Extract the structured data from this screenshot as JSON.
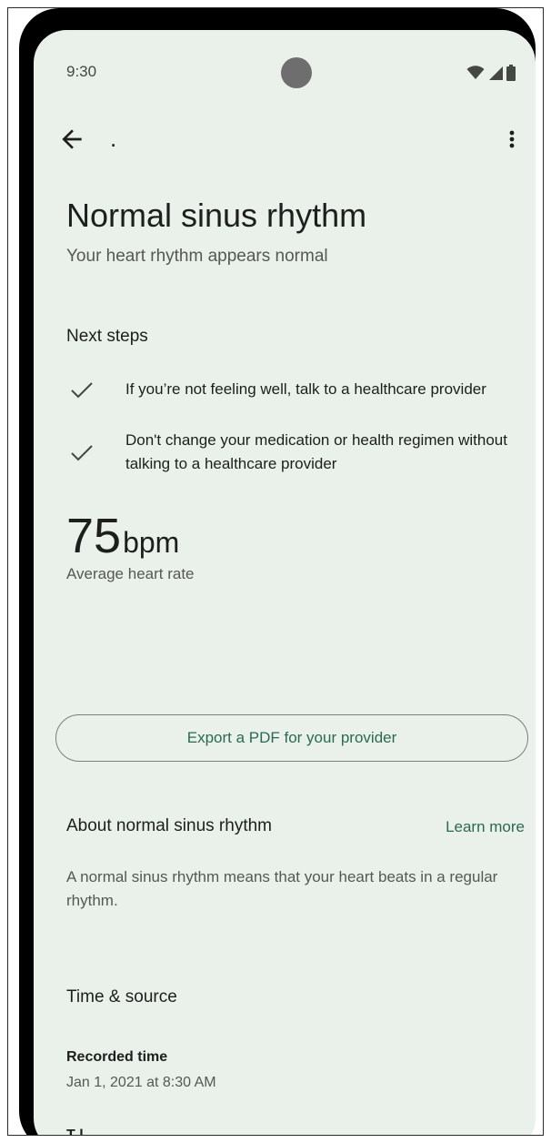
{
  "status_bar": {
    "time": "9:30",
    "icons": [
      "wifi-icon",
      "cell-signal-icon",
      "battery-icon"
    ]
  },
  "app_bar": {
    "title": ".",
    "back_icon": "arrow-left-icon",
    "more_icon": "more-vert-icon"
  },
  "result": {
    "title": "Normal sinus rhythm",
    "subtitle": "Your heart rhythm appears normal"
  },
  "next_steps": {
    "heading": "Next steps",
    "items": [
      {
        "icon": "check-icon",
        "text": "If you’re not feeling well, talk to a healthcare provider"
      },
      {
        "icon": "check-icon",
        "text": "Don't change your medication or health regimen without talking to a healthcare provider"
      }
    ]
  },
  "heart_rate": {
    "value": "75",
    "unit": "bpm",
    "label": "Average heart rate"
  },
  "export_button": {
    "label": "Export a PDF for your provider"
  },
  "about": {
    "heading": "About normal sinus rhythm",
    "learn_more": "Learn more",
    "body": "A normal sinus rhythm means that your heart beats in a regular rhythm."
  },
  "time_source": {
    "heading": "Time & source",
    "recorded_label": "Recorded time",
    "recorded_value": "Jan 1, 2021 at 8:30 AM",
    "next_label_partial": "T l"
  },
  "colors": {
    "background": "#eaf0ea",
    "accent": "#2a6a55",
    "text_primary": "#1d1f1d",
    "text_secondary": "#555955"
  }
}
